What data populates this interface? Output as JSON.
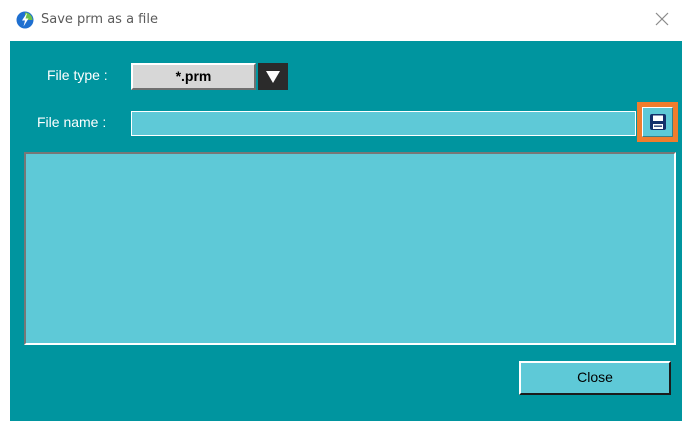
{
  "window": {
    "title": "Save prm as a file",
    "app_icon": "app-logo-icon",
    "close_icon": "close-icon"
  },
  "form": {
    "file_type_label": "File type :",
    "file_type_value": "*.prm",
    "file_type_dropdown_icon": "triangle-down-icon",
    "file_name_label": "File name :",
    "file_name_value": "",
    "save_icon": "floppy-disk-icon"
  },
  "buttons": {
    "close_label": "Close"
  },
  "colors": {
    "dialog_background": "#00959f",
    "field_background": "#5ec9d7",
    "save_highlight": "#f07d2d",
    "combo_arrow": "#2b2b2b"
  }
}
